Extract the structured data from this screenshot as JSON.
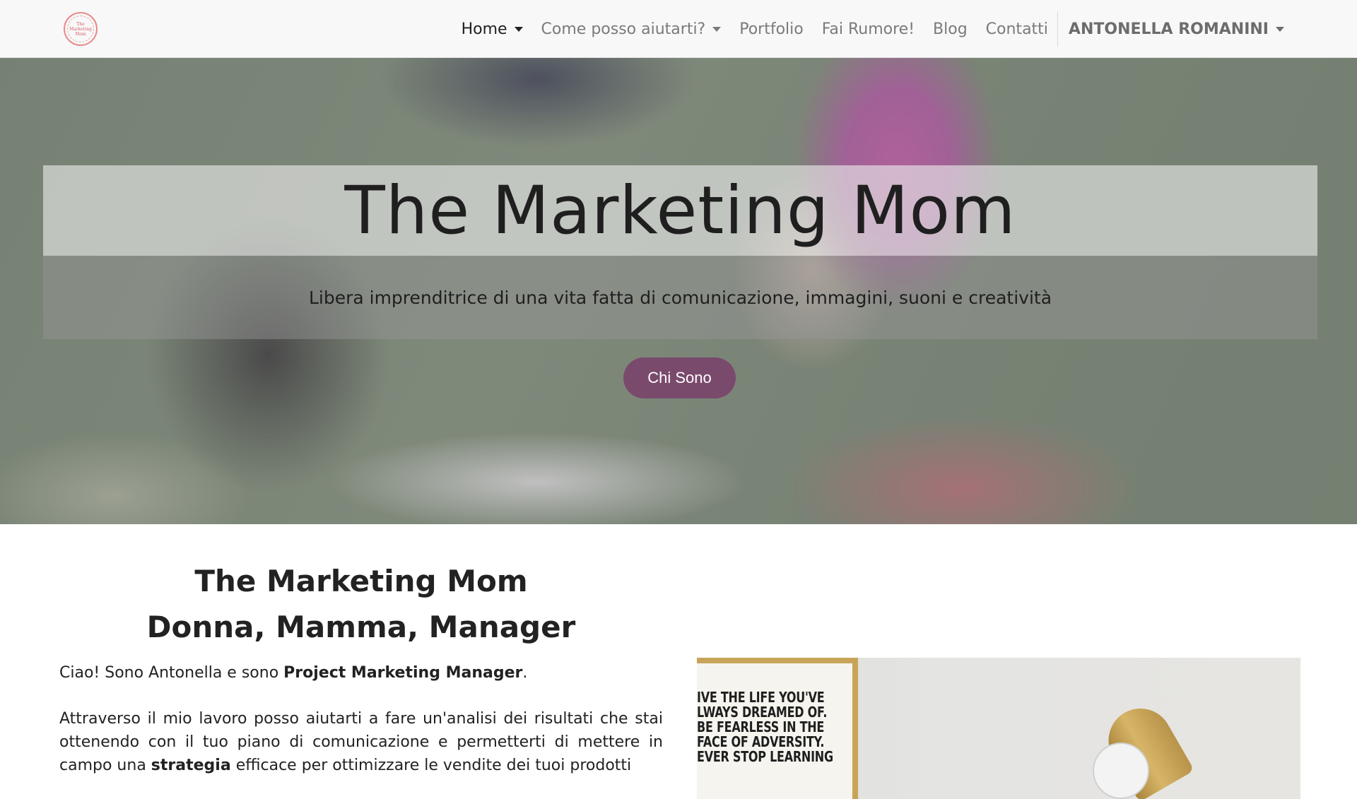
{
  "navbar": {
    "logo_text": "The Marketing Mom",
    "items": [
      {
        "label": "Home",
        "dropdown": true,
        "active": true
      },
      {
        "label": "Come posso aiutarti?",
        "dropdown": true
      },
      {
        "label": "Portfolio"
      },
      {
        "label": "Fai Rumore!"
      },
      {
        "label": "Blog"
      },
      {
        "label": "Contatti"
      }
    ],
    "user": {
      "label": "ANTONELLA ROMANINI",
      "dropdown": true
    }
  },
  "hero": {
    "title": "The Marketing Mom",
    "subtitle": "Libera imprenditrice di una vita fatta di comunicazione, immagini, suoni e creatività",
    "button_label": "Chi Sono"
  },
  "about": {
    "heading_line1": "The Marketing Mom",
    "heading_line2": "Donna, Mamma, Manager",
    "p1_pre": "Ciao! Sono Antonella e sono ",
    "p1_bold": "Project Marketing Manager",
    "p1_post": ".",
    "p2_pre": "Attraverso il mio lavoro posso aiutarti a fare un'analisi dei risultati che stai ottenendo con il tuo piano di comunicazione e permetterti di mettere in campo una ",
    "p2_bold": "strategia",
    "p2_line3": "efficace per ottimizzare le vendite dei tuoi prodotti"
  },
  "poster": {
    "lines": [
      "IVE THE LIFE YOU'VE",
      "LWAYS DREAMED OF.",
      "BE FEARLESS IN THE",
      "FACE OF ADVERSITY.",
      "EVER STOP LEARNING"
    ]
  },
  "colors": {
    "accent": "#7a4a6d",
    "navbar_bg": "#f8f8f8",
    "logo": "#e98a8a"
  }
}
